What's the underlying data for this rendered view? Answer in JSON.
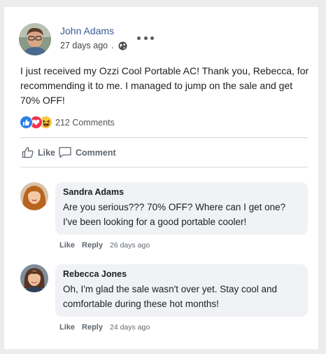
{
  "post": {
    "author": "John Adams",
    "time": "27 days ago",
    "separator": ".",
    "body": "I just received my Ozzi Cool Portable AC! Thank you, Rebecca, for recommending it to me. I managed to jump on the sale and get 70% OFF!",
    "comment_count": "212 Comments",
    "reaction_icons": [
      "like-reaction",
      "love-reaction",
      "haha-reaction"
    ],
    "like_label": "Like",
    "comment_label": "Comment"
  },
  "comments": [
    {
      "name": "Sandra Adams",
      "text": "Are you serious??? 70% OFF? Where can I get one? I've been looking for a good portable cooler!",
      "like_label": "Like",
      "reply_label": "Reply",
      "time": "26 days ago"
    },
    {
      "name": "Rebecca Jones",
      "text": "Oh, I'm glad the sale wasn't over yet. Stay cool and comfortable during these hot months!",
      "like_label": "Like",
      "reply_label": "Reply",
      "time": "24 days ago"
    }
  ],
  "colors": {
    "author_link": "#3a5a9a",
    "like_reaction": "#2d7fe8",
    "love_reaction": "#f0334f",
    "haha_reaction": "#f8c73a",
    "bubble_bg": "#f0f2f5"
  }
}
